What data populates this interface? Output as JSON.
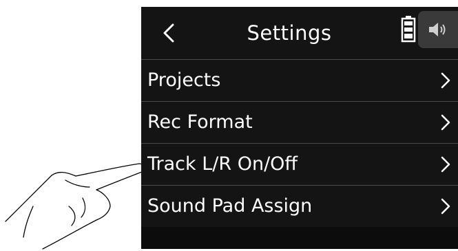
{
  "header": {
    "title": "Settings",
    "back_icon": "chevron-left-icon",
    "battery_icon": "battery-icon",
    "speaker_icon": "speaker-icon"
  },
  "menu": {
    "items": [
      {
        "label": "Projects",
        "icon": "chevron-right-icon"
      },
      {
        "label": "Rec Format",
        "icon": "chevron-right-icon"
      },
      {
        "label": "Track L/R On/Off",
        "icon": "chevron-right-icon"
      },
      {
        "label": "Sound Pad Assign",
        "icon": "chevron-right-icon"
      }
    ]
  },
  "colors": {
    "screen_bg": "#141414",
    "text": "#ffffff",
    "divider": "#4a4a4a",
    "tab_bg": "#3a3a3a"
  }
}
